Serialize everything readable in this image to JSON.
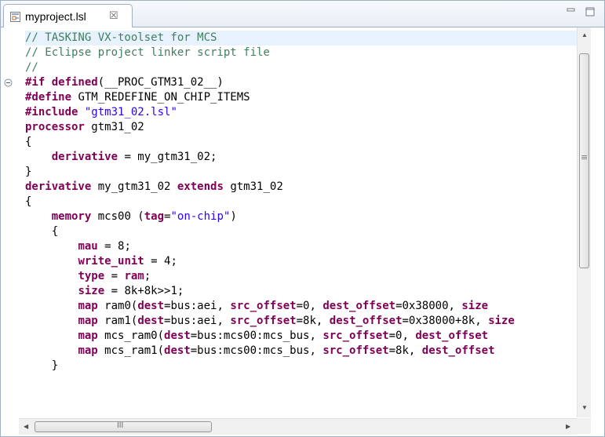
{
  "tab": {
    "icon": "linker-script-file-icon",
    "label": "myproject.lsl",
    "close_label": "☒"
  },
  "window_controls": {
    "minimize_icon": "minimize-icon",
    "maximize_icon": "maximize-icon"
  },
  "scrollbars": {
    "horizontal_grip": "III",
    "vertical_grip": "≡"
  },
  "editor": {
    "current_line": 0,
    "fold_line": 3,
    "lines": [
      [
        [
          "c",
          "// TASKING VX-toolset for MCS"
        ]
      ],
      [
        [
          "c",
          "// Eclipse project linker script file"
        ]
      ],
      [
        [
          "c",
          "//"
        ]
      ],
      [
        [
          "k",
          "#if defined"
        ],
        [
          "t",
          "(__PROC_GTM31_02__)"
        ]
      ],
      [
        [
          "k",
          "#define"
        ],
        [
          "t",
          " GTM_REDEFINE_ON_CHIP_ITEMS"
        ]
      ],
      [
        [
          "k",
          "#include"
        ],
        [
          "t",
          " "
        ],
        [
          "s",
          "\"gtm31_02.lsl\""
        ]
      ],
      [
        [
          "k",
          "processor"
        ],
        [
          "t",
          " gtm31_02"
        ]
      ],
      [
        [
          "t",
          "{"
        ]
      ],
      [
        [
          "t",
          "    "
        ],
        [
          "k",
          "derivative"
        ],
        [
          "t",
          " = my_gtm31_02;"
        ]
      ],
      [
        [
          "t",
          "}"
        ]
      ],
      [
        [
          "k",
          "derivative"
        ],
        [
          "t",
          " my_gtm31_02 "
        ],
        [
          "k",
          "extends"
        ],
        [
          "t",
          " gtm31_02"
        ]
      ],
      [
        [
          "t",
          "{"
        ]
      ],
      [
        [
          "t",
          "    "
        ],
        [
          "k",
          "memory"
        ],
        [
          "t",
          " mcs00 ("
        ],
        [
          "k",
          "tag"
        ],
        [
          "t",
          "="
        ],
        [
          "s",
          "\"on-chip\""
        ],
        [
          "t",
          ")"
        ]
      ],
      [
        [
          "t",
          "    {"
        ]
      ],
      [
        [
          "t",
          "        "
        ],
        [
          "k",
          "mau"
        ],
        [
          "t",
          " = 8;"
        ]
      ],
      [
        [
          "t",
          "        "
        ],
        [
          "k",
          "write_unit"
        ],
        [
          "t",
          " = 4;"
        ]
      ],
      [
        [
          "t",
          "        "
        ],
        [
          "k",
          "type"
        ],
        [
          "t",
          " = "
        ],
        [
          "k",
          "ram"
        ],
        [
          "t",
          ";"
        ]
      ],
      [
        [
          "t",
          "        "
        ],
        [
          "k",
          "size"
        ],
        [
          "t",
          " = 8k+8k>>1;"
        ]
      ],
      [
        [
          "t",
          "        "
        ],
        [
          "k",
          "map"
        ],
        [
          "t",
          " ram0("
        ],
        [
          "k",
          "dest"
        ],
        [
          "t",
          "=bus:aei, "
        ],
        [
          "k",
          "src_offset"
        ],
        [
          "t",
          "=0, "
        ],
        [
          "k",
          "dest_offset"
        ],
        [
          "t",
          "=0x38000, "
        ],
        [
          "k",
          "size"
        ]
      ],
      [
        [
          "t",
          "        "
        ],
        [
          "k",
          "map"
        ],
        [
          "t",
          " ram1("
        ],
        [
          "k",
          "dest"
        ],
        [
          "t",
          "=bus:aei, "
        ],
        [
          "k",
          "src_offset"
        ],
        [
          "t",
          "=8k, "
        ],
        [
          "k",
          "dest_offset"
        ],
        [
          "t",
          "=0x38000+8k, "
        ],
        [
          "k",
          "size"
        ]
      ],
      [
        [
          "t",
          "        "
        ],
        [
          "k",
          "map"
        ],
        [
          "t",
          " mcs_ram0("
        ],
        [
          "k",
          "dest"
        ],
        [
          "t",
          "=bus:mcs00:mcs_bus, "
        ],
        [
          "k",
          "src_offset"
        ],
        [
          "t",
          "=0, "
        ],
        [
          "k",
          "dest_offset"
        ]
      ],
      [
        [
          "t",
          "        "
        ],
        [
          "k",
          "map"
        ],
        [
          "t",
          " mcs_ram1("
        ],
        [
          "k",
          "dest"
        ],
        [
          "t",
          "=bus:mcs00:mcs_bus, "
        ],
        [
          "k",
          "src_offset"
        ],
        [
          "t",
          "=8k, "
        ],
        [
          "k",
          "dest_offset"
        ]
      ],
      [
        [
          "t",
          "    }"
        ]
      ]
    ]
  }
}
